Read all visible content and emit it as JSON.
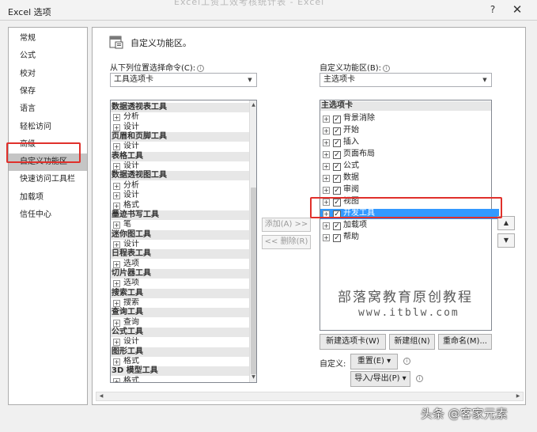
{
  "window": {
    "title": "Excel 选项",
    "background_title": "Excel工资工效考核统计表 - Excel",
    "help": "?",
    "close": "✕"
  },
  "nav": {
    "items": [
      "常规",
      "公式",
      "校对",
      "保存",
      "语言",
      "轻松访问",
      "高级",
      "自定义功能区",
      "快速访问工具栏",
      "加载项",
      "信任中心"
    ],
    "selected": "自定义功能区"
  },
  "header": {
    "title": "自定义功能区。"
  },
  "left_panel": {
    "label": "从下列位置选择命令(C):",
    "combo_value": "工具选项卡",
    "rows": [
      {
        "t": "h",
        "text": "数据透视表工具"
      },
      {
        "t": "i",
        "text": "分析"
      },
      {
        "t": "i",
        "text": "设计"
      },
      {
        "t": "h",
        "text": "页眉和页脚工具"
      },
      {
        "t": "i",
        "text": "设计"
      },
      {
        "t": "h",
        "text": "表格工具"
      },
      {
        "t": "i",
        "text": "设计"
      },
      {
        "t": "h",
        "text": "数据透视图工具"
      },
      {
        "t": "i",
        "text": "分析"
      },
      {
        "t": "i",
        "text": "设计"
      },
      {
        "t": "i",
        "text": "格式"
      },
      {
        "t": "h",
        "text": "墨迹书写工具"
      },
      {
        "t": "i",
        "text": "笔"
      },
      {
        "t": "h",
        "text": "迷你图工具"
      },
      {
        "t": "i",
        "text": "设计"
      },
      {
        "t": "h",
        "text": "日程表工具"
      },
      {
        "t": "i",
        "text": "选项"
      },
      {
        "t": "h",
        "text": "切片器工具"
      },
      {
        "t": "i",
        "text": "选项"
      },
      {
        "t": "h",
        "text": "搜索工具"
      },
      {
        "t": "i",
        "text": "搜索"
      },
      {
        "t": "h",
        "text": "查询工具"
      },
      {
        "t": "i",
        "text": "查询"
      },
      {
        "t": "h",
        "text": "公式工具"
      },
      {
        "t": "i",
        "text": "设计"
      },
      {
        "t": "h",
        "text": "图形工具"
      },
      {
        "t": "i",
        "text": "格式"
      },
      {
        "t": "h",
        "text": "3D 模型工具"
      },
      {
        "t": "i",
        "text": "格式"
      }
    ]
  },
  "middle": {
    "add_label": "添加(A) >>",
    "remove_label": "<< 删除(R)"
  },
  "right_panel": {
    "label": "自定义功能区(B):",
    "combo_value": "主选项卡",
    "header": "主选项卡",
    "items": [
      "背景消除",
      "开始",
      "插入",
      "页面布局",
      "公式",
      "数据",
      "审阅",
      "视图",
      "开发工具",
      "加载项",
      "帮助"
    ],
    "selected": "开发工具"
  },
  "buttons": {
    "new_tab": "新建选项卡(W)",
    "new_group": "新建组(N)",
    "rename": "重命名(M)...",
    "customize_label": "自定义:",
    "reset": "重置(E) ▾",
    "import_export": "导入/导出(P) ▾"
  },
  "watermark": {
    "line1": "部落窝教育原创教程",
    "line2": "www.itblw.com",
    "bottom": "头条 @客家元素"
  },
  "icons": {
    "check": "✓",
    "expand": "+",
    "up": "▲",
    "down": "▼",
    "left": "◀",
    "right": "▶",
    "info": "i"
  },
  "colors": {
    "highlight": "#e0302b",
    "selection": "#3399ff"
  }
}
